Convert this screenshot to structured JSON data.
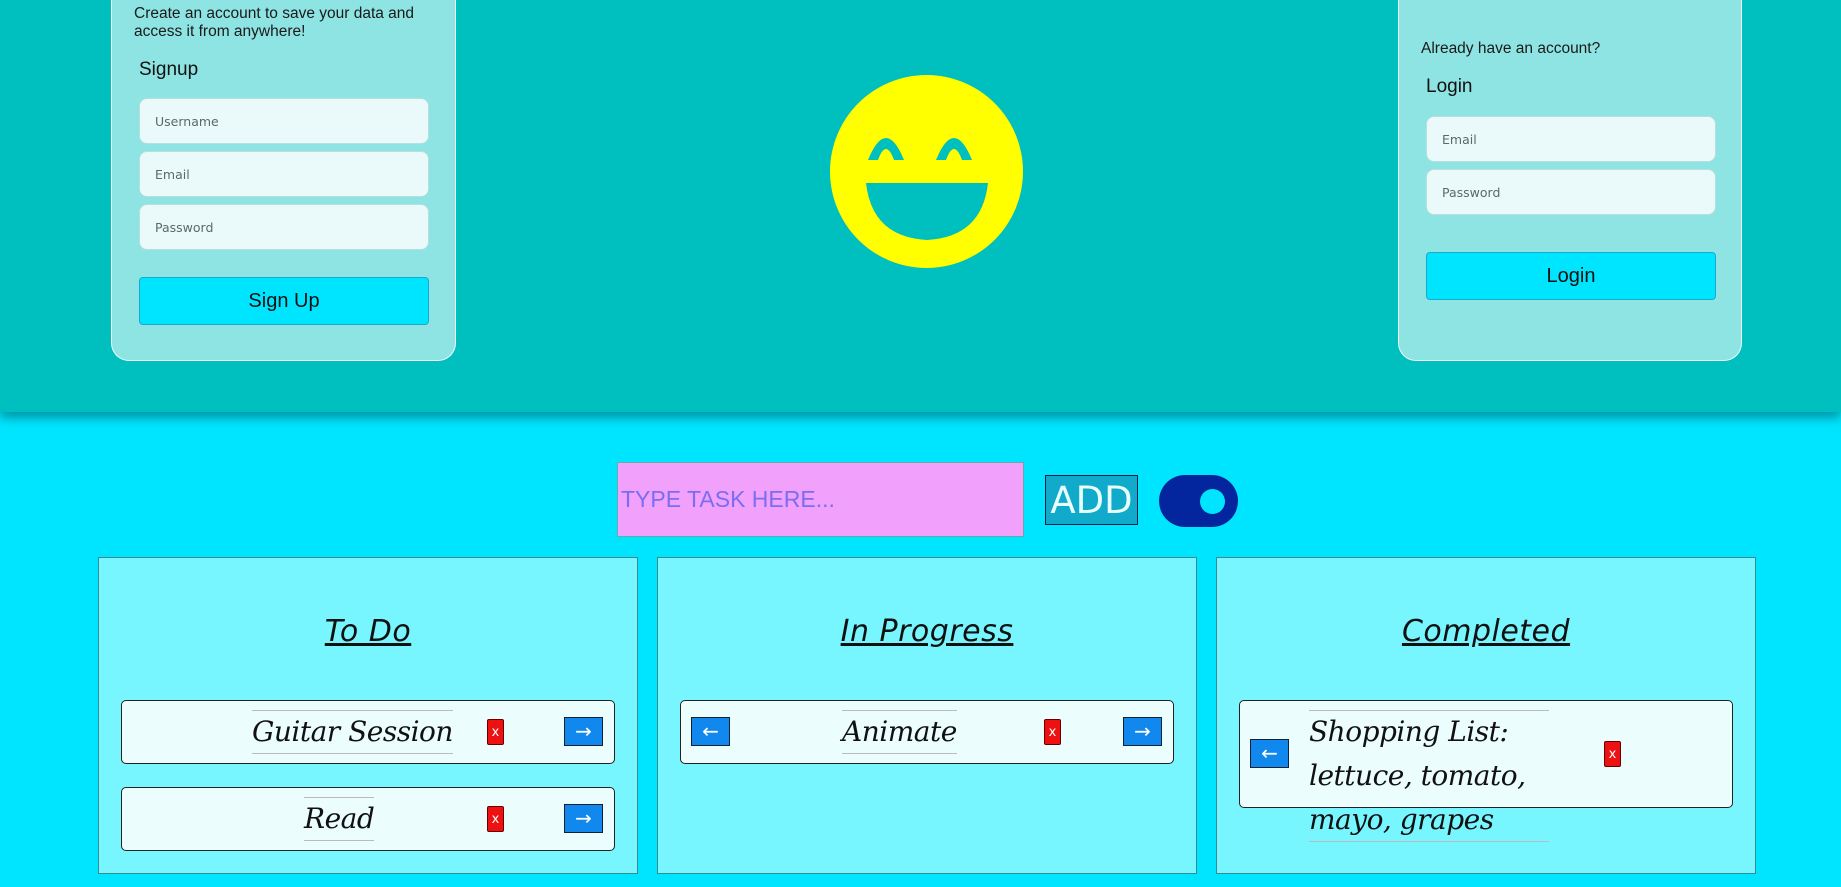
{
  "signup": {
    "intro": "Create an account to save your data and access it from anywhere!",
    "heading": "Signup",
    "username_placeholder": "Username",
    "email_placeholder": "Email",
    "password_placeholder": "Password",
    "button_label": "Sign Up"
  },
  "login": {
    "intro": "Already have an account?",
    "heading": "Login",
    "email_placeholder": "Email",
    "password_placeholder": "Password",
    "button_label": "Login"
  },
  "mascot": {
    "icon": "laughing-smiley-face-icon",
    "color": "#ffff00"
  },
  "task_entry": {
    "placeholder": "TYPE TASK HERE...",
    "add_label": "ADD",
    "theme_toggle_on": true
  },
  "columns": [
    {
      "title": "To Do",
      "tasks": [
        {
          "text": "Guitar Session",
          "delete_label": "x",
          "next_label": "→"
        },
        {
          "text": "Read",
          "delete_label": "x",
          "next_label": "→"
        }
      ]
    },
    {
      "title": "In Progress",
      "tasks": [
        {
          "text": "Animate",
          "prev_label": "←",
          "delete_label": "x",
          "next_label": "→"
        }
      ]
    },
    {
      "title": "Completed",
      "tasks": [
        {
          "text": "Shopping List: lettuce, tomato, mayo, grapes",
          "prev_label": "←",
          "delete_label": "x"
        }
      ]
    }
  ],
  "colors": {
    "header_bg": "#00bfbf",
    "page_bg": "#00e5ff",
    "card_bg": "#8ee3e3",
    "column_bg": "#77f6ff",
    "input_bg": "#f1a1fc",
    "delete": "#ee1111",
    "move": "#1188ee",
    "toggle": "#03269e"
  }
}
